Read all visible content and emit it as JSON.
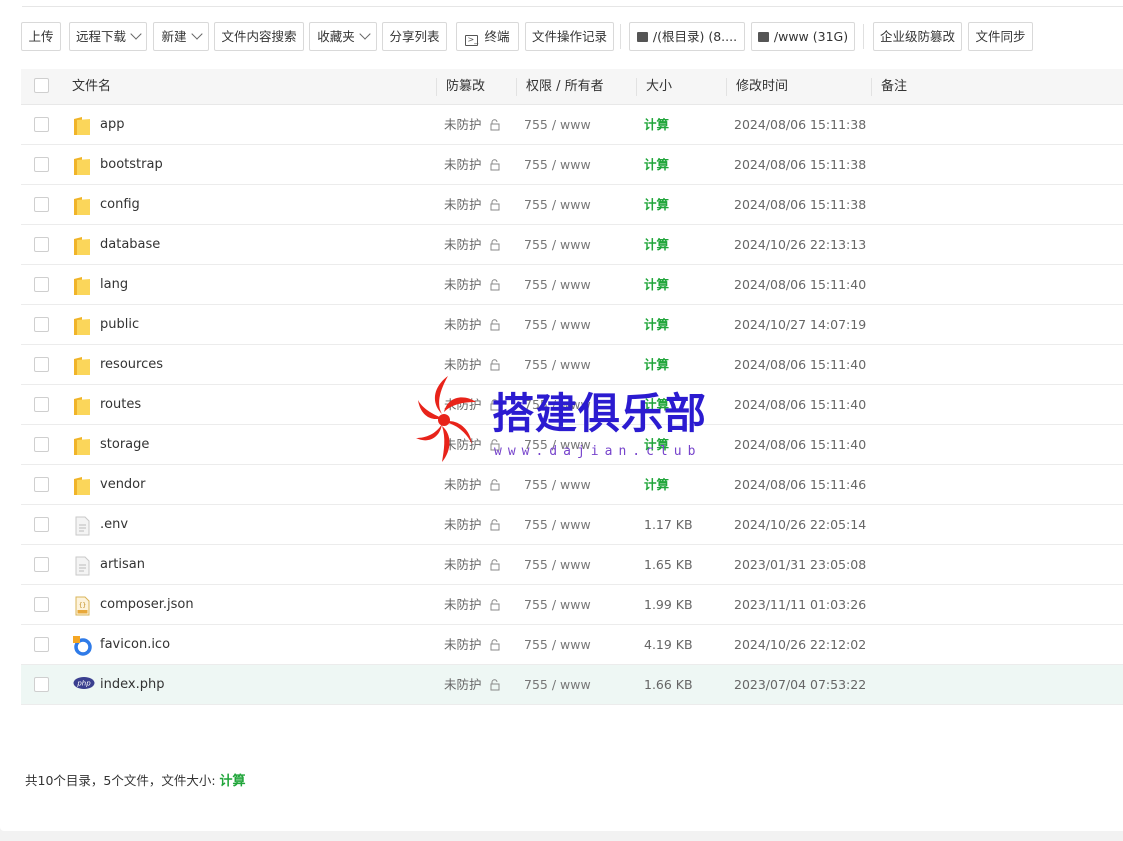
{
  "toolbar": {
    "upload": "上传",
    "remote_download": "远程下载",
    "new": "新建",
    "content_search": "文件内容搜索",
    "favorites": "收藏夹",
    "share_list": "分享列表",
    "terminal": "终端",
    "op_log": "文件操作记录",
    "disk_root": "/(根目录) (8....",
    "disk_www": "/www (31G)",
    "enterprise_tamper": "企业级防篡改",
    "file_sync": "文件同步"
  },
  "table": {
    "headers": {
      "name": "文件名",
      "tamper": "防篡改",
      "perm": "权限 / 所有者",
      "size": "大小",
      "mtime": "修改时间",
      "note": "备注"
    },
    "rows": [
      {
        "name": "app",
        "type": "folder",
        "protect": "未防护",
        "perm": "755 / www",
        "size": "计算",
        "mtime": "2024/08/06 15:11:38"
      },
      {
        "name": "bootstrap",
        "type": "folder",
        "protect": "未防护",
        "perm": "755 / www",
        "size": "计算",
        "mtime": "2024/08/06 15:11:38"
      },
      {
        "name": "config",
        "type": "folder",
        "protect": "未防护",
        "perm": "755 / www",
        "size": "计算",
        "mtime": "2024/08/06 15:11:38"
      },
      {
        "name": "database",
        "type": "folder",
        "protect": "未防护",
        "perm": "755 / www",
        "size": "计算",
        "mtime": "2024/10/26 22:13:13"
      },
      {
        "name": "lang",
        "type": "folder",
        "protect": "未防护",
        "perm": "755 / www",
        "size": "计算",
        "mtime": "2024/08/06 15:11:40"
      },
      {
        "name": "public",
        "type": "folder",
        "protect": "未防护",
        "perm": "755 / www",
        "size": "计算",
        "mtime": "2024/10/27 14:07:19"
      },
      {
        "name": "resources",
        "type": "folder",
        "protect": "未防护",
        "perm": "755 / www",
        "size": "计算",
        "mtime": "2024/08/06 15:11:40"
      },
      {
        "name": "routes",
        "type": "folder",
        "protect": "未防护",
        "perm": "755 / www",
        "size": "计算",
        "mtime": "2024/08/06 15:11:40"
      },
      {
        "name": "storage",
        "type": "folder",
        "protect": "未防护",
        "perm": "755 / www",
        "size": "计算",
        "mtime": "2024/08/06 15:11:40"
      },
      {
        "name": "vendor",
        "type": "folder",
        "protect": "未防护",
        "perm": "755 / www",
        "size": "计算",
        "mtime": "2024/08/06 15:11:46"
      },
      {
        "name": ".env",
        "type": "text",
        "protect": "未防护",
        "perm": "755 / www",
        "size": "1.17 KB",
        "mtime": "2024/10/26 22:05:14"
      },
      {
        "name": "artisan",
        "type": "text",
        "protect": "未防护",
        "perm": "755 / www",
        "size": "1.65 KB",
        "mtime": "2023/01/31 23:05:08"
      },
      {
        "name": "composer.json",
        "type": "json",
        "protect": "未防护",
        "perm": "755 / www",
        "size": "1.99 KB",
        "mtime": "2023/11/11 01:03:26"
      },
      {
        "name": "favicon.ico",
        "type": "ico",
        "protect": "未防护",
        "perm": "755 / www",
        "size": "4.19 KB",
        "mtime": "2024/10/26 22:12:02"
      },
      {
        "name": "index.php",
        "type": "php",
        "protect": "未防护",
        "perm": "755 / www",
        "size": "1.66 KB",
        "mtime": "2023/07/04 07:53:22"
      }
    ]
  },
  "footer": {
    "summary": "共10个目录，5个文件，文件大小: ",
    "calc": "计算"
  },
  "watermark": {
    "title": "搭建俱乐部",
    "subtitle": "www.dajian.club"
  },
  "colors": {
    "accent_green": "#20a53a",
    "folder_yellow": "#f7c948",
    "highlight_row": "#eef7f4",
    "watermark_blue": "#2b1bd0",
    "watermark_red": "#e8231a"
  }
}
